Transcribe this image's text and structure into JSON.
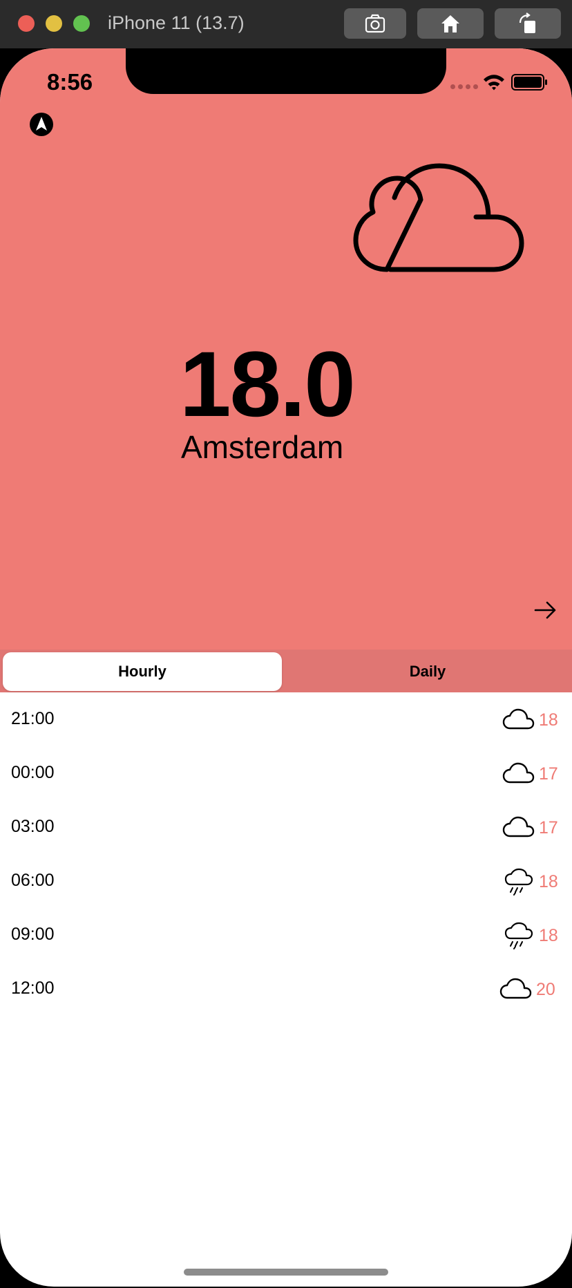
{
  "simulator": {
    "title": "iPhone 11 (13.7)",
    "buttons": [
      "camera-icon",
      "home-icon",
      "rotate-icon"
    ]
  },
  "status_bar": {
    "time": "8:56"
  },
  "weather": {
    "temperature": "18.0",
    "city": "Amsterdam",
    "condition_icon": "cloud-icon",
    "accent_color": "#ef7b75"
  },
  "tabs": [
    {
      "label": "Hourly",
      "selected": true
    },
    {
      "label": "Daily",
      "selected": false
    }
  ],
  "hourly": [
    {
      "time": "21:00",
      "icon": "cloud-icon",
      "temp": "18"
    },
    {
      "time": "00:00",
      "icon": "cloud-icon",
      "temp": "17"
    },
    {
      "time": "03:00",
      "icon": "cloud-icon",
      "temp": "17"
    },
    {
      "time": "06:00",
      "icon": "rain-icon",
      "temp": "18"
    },
    {
      "time": "09:00",
      "icon": "rain-icon",
      "temp": "18"
    },
    {
      "time": "12:00",
      "icon": "cloud-icon",
      "temp": "20"
    }
  ]
}
